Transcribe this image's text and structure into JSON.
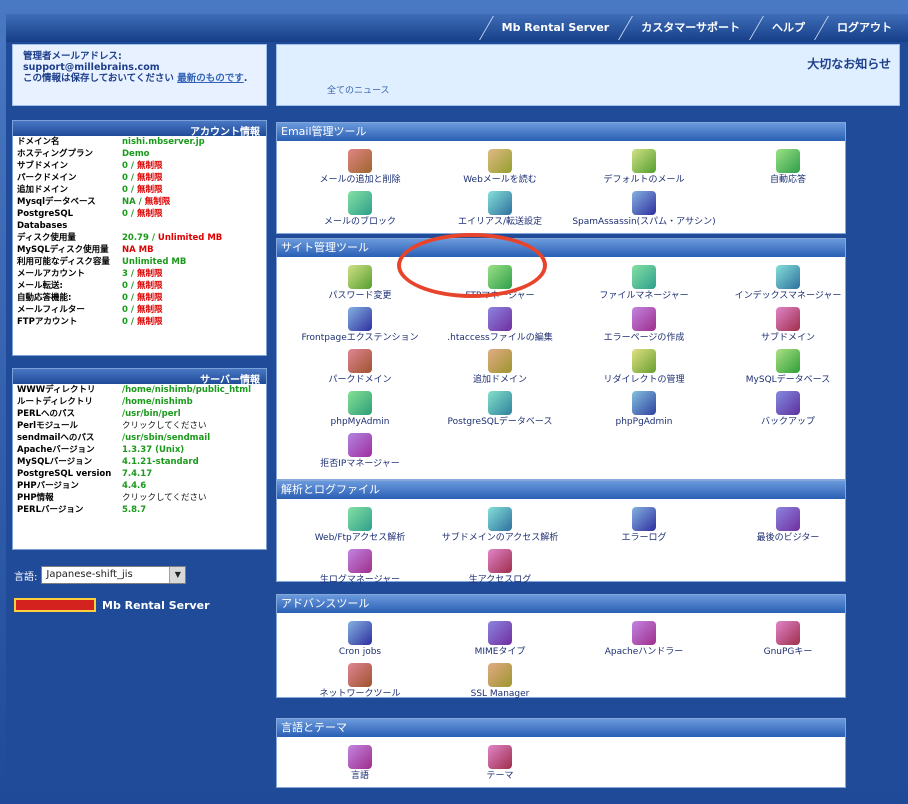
{
  "topnav": [
    "Mb Rental Server",
    "カスタマーサポート",
    "ヘルプ",
    "ログアウト"
  ],
  "admin": {
    "line1": "管理者メールアドレス:",
    "line2": "support@millebrains.com",
    "line3": "この情報は保存しておいてください",
    "link": "最新のものです",
    "suffix": "."
  },
  "news": {
    "title": "大切なお知らせ",
    "all": "全てのニュース"
  },
  "account": {
    "title": "アカウント情報",
    "rows": [
      [
        "ドメイン名",
        "nishi.mbserver.jp",
        ""
      ],
      [
        "ホスティングプラン",
        "Demo",
        ""
      ],
      [
        "サブドメイン",
        "0 / ",
        "無制限"
      ],
      [
        "パークドメイン",
        "0 / ",
        "無制限"
      ],
      [
        "追加ドメイン",
        "0 / ",
        "無制限"
      ],
      [
        "Mysqlデータベース",
        "NA / ",
        "無制限"
      ],
      [
        "PostgreSQL Databases",
        "0 / ",
        "無制限"
      ],
      [
        "ディスク使用量",
        "20.79 / ",
        "Unlimited MB"
      ],
      [
        "MySQLディスク使用量",
        "",
        "NA MB"
      ],
      [
        "利用可能なディスク容量",
        "Unlimited MB",
        ""
      ],
      [
        "メールアカウント",
        "3 / ",
        "無制限"
      ],
      [
        "メール転送:",
        "0 / ",
        "無制限"
      ],
      [
        "自動応答機能:",
        "0 / ",
        "無制限"
      ],
      [
        "メールフィルター",
        "0 / ",
        "無制限"
      ],
      [
        "FTPアカウント",
        "0 / ",
        "無制限"
      ]
    ]
  },
  "server": {
    "title": "サーバー情報",
    "rows": [
      [
        "WWWディレクトリ",
        "/home/nishimb/public_html"
      ],
      [
        "ルートディレクトリ",
        "/home/nishimb"
      ],
      [
        "PERLへのパス",
        "/usr/bin/perl"
      ],
      [
        "Perlモジュール",
        "クリックしてください"
      ],
      [
        "sendmailへのパス",
        "/usr/sbin/sendmail"
      ],
      [
        "Apacheバージョン",
        "1.3.37 (Unix)"
      ],
      [
        "MySQLバージョン",
        "4.1.21-standard"
      ],
      [
        "PostgreSQL version",
        "7.4.17"
      ],
      [
        "PHPバージョン",
        "4.4.6"
      ],
      [
        "PHP情報",
        "クリックしてください"
      ],
      [
        "PERLバージョン",
        "5.8.7"
      ]
    ]
  },
  "language": {
    "label": "言語:",
    "value": "Japanese-shift_jis"
  },
  "brand": {
    "text": "Mb Rental Server"
  },
  "sections": [
    {
      "title": "Email管理ツール",
      "items": [
        "メールの追加と削除",
        "Webメールを読む",
        "デフォルトのメール",
        "自動応答",
        "メールのブロック",
        "エイリアス/転送設定",
        "SpamAssassin(スパム・アサシン)"
      ]
    },
    {
      "title": "サイト管理ツール",
      "items": [
        "パスワード変更",
        "FTPマネージャー",
        "ファイルマネージャー",
        "インデックスマネージャー",
        "Frontpageエクステンション",
        ".htaccessファイルの編集",
        "エラーページの作成",
        "サブドメイン",
        "パークドメイン",
        "追加ドメイン",
        "リダイレクトの管理",
        "MySQLデータベース",
        "phpMyAdmin",
        "PostgreSQLデータベース",
        "phpPgAdmin",
        "バックアップ",
        "拒否IPマネージャー"
      ]
    },
    {
      "title": "解析とログファイル",
      "items": [
        "Web/Ftpアクセス解析",
        "サブドメインのアクセス解析",
        "エラーログ",
        "最後のビジター",
        "生ログマネージャー",
        "生アクセスログ"
      ]
    },
    {
      "title": "アドバンスツール",
      "items": [
        "Cron jobs",
        "MIMEタイプ",
        "Apacheハンドラー",
        "GnuPGキー",
        "ネットワークツール",
        "SSL Manager"
      ]
    },
    {
      "title": "言語とテーマ",
      "items": [
        "言語",
        "テーマ"
      ]
    }
  ]
}
